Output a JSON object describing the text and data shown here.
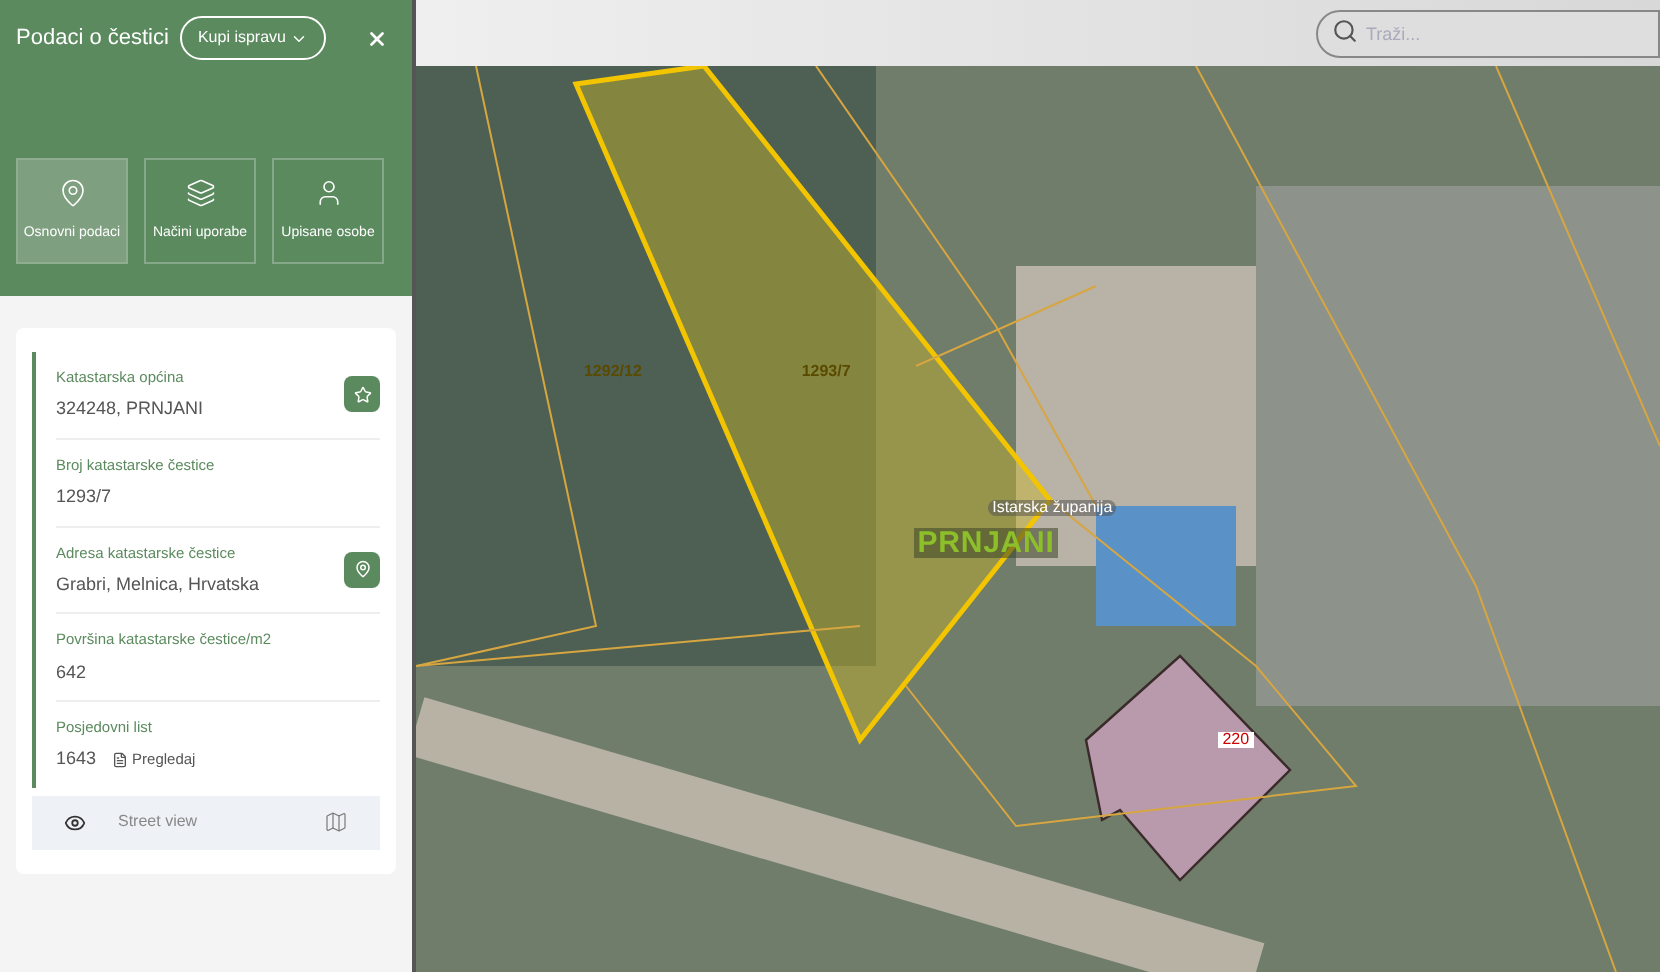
{
  "panel": {
    "title": "Podaci o čestici",
    "buy_button": "Kupi ispravu",
    "tabs": [
      {
        "label": "Osnovni podaci",
        "selected": true
      },
      {
        "label": "Načini uporabe",
        "selected": false
      },
      {
        "label": "Upisane osobe",
        "selected": false
      }
    ],
    "fields": [
      {
        "label": "Katastarska općina",
        "value": "324248, PRNJANI",
        "kind": "favorite"
      },
      {
        "label": "Broj katastarske čestice",
        "value": "1293/7",
        "kind": "plain"
      },
      {
        "label": "Adresa katastarske čestice",
        "value": "Grabri, Melnica, Hrvatska",
        "kind": "location"
      },
      {
        "label": "Površina katastarske čestice/m2",
        "value": "642",
        "kind": "plain"
      },
      {
        "label": "Posjedovni list",
        "value": "1643",
        "kind": "document",
        "link": "Pregledaj"
      }
    ],
    "street_view": "Street view"
  },
  "search": {
    "placeholder": "Traži..."
  },
  "map": {
    "labels": [
      {
        "text": "1292/12",
        "kind": "parcel"
      },
      {
        "text": "1293/7",
        "kind": "parcel"
      },
      {
        "text": "Istarska županija",
        "kind": "county"
      },
      {
        "text": "PRNJANI",
        "kind": "place"
      },
      {
        "text": "220",
        "kind": "building"
      }
    ]
  }
}
